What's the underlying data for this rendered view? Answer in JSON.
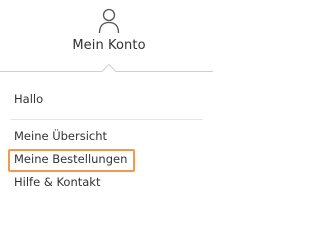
{
  "header": {
    "icon": "user-icon",
    "label": "Mein Konto"
  },
  "menu": {
    "greeting": "Hallo",
    "items": [
      {
        "label": "Meine Übersicht"
      },
      {
        "label": "Meine Bestellungen",
        "highlighted": true
      },
      {
        "label": "Hilfe & Kontakt"
      }
    ]
  },
  "colors": {
    "highlight": "#f39a4a",
    "text": "#333333",
    "divider": "#d6d6d6"
  }
}
